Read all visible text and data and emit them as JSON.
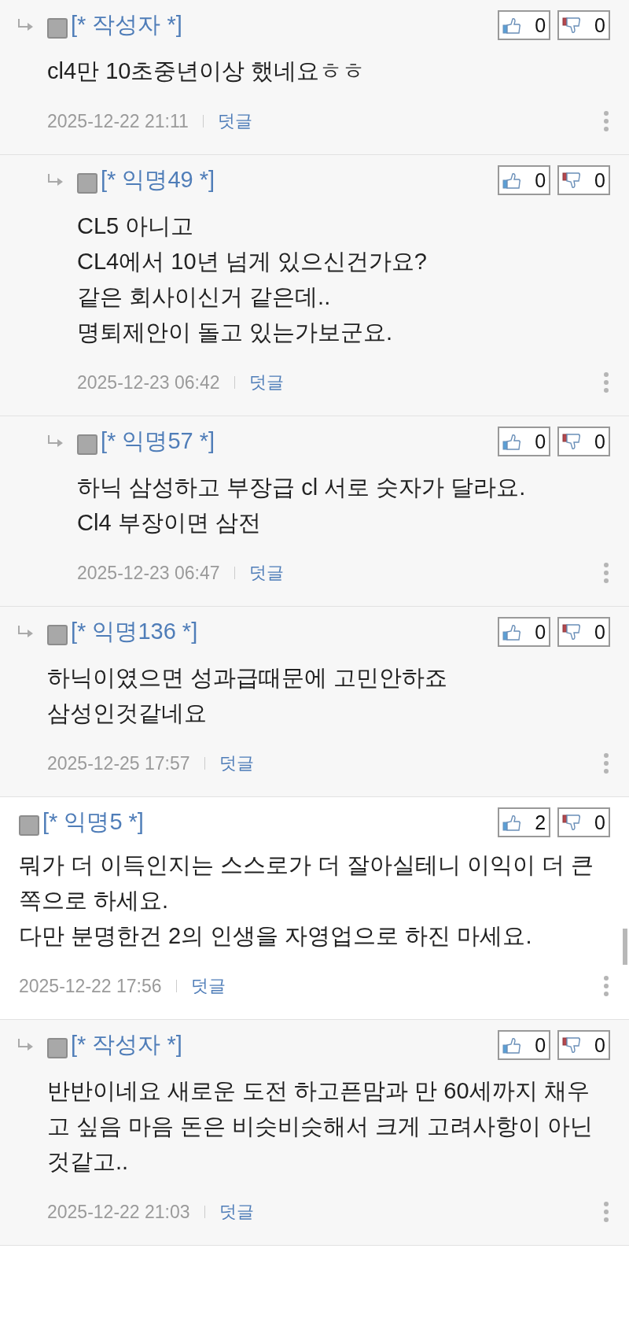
{
  "comments": [
    {
      "reply": true,
      "author": "[* 작성자 *]",
      "likes": "0",
      "dislikes": "0",
      "body": "cl4만 10초중년이상 했네요ㅎㅎ",
      "date": "2025-12-22 21:11",
      "reply_link": "덧글",
      "children": [
        {
          "reply": true,
          "author": "[* 익명49 *]",
          "likes": "0",
          "dislikes": "0",
          "body": "CL5 아니고\nCL4에서 10년 넘게 있으신건가요?\n같은 회사이신거 같은데..\n명퇴제안이 돌고 있는가보군요.",
          "date": "2025-12-23 06:42",
          "reply_link": "덧글"
        },
        {
          "reply": true,
          "author": "[* 익명57 *]",
          "likes": "0",
          "dislikes": "0",
          "body": "하닉 삼성하고 부장급 cl 서로 숫자가 달라요.\nCl4 부장이면 삼전",
          "date": "2025-12-23 06:47",
          "reply_link": "덧글"
        }
      ]
    },
    {
      "reply": true,
      "author": "[* 익명136 *]",
      "likes": "0",
      "dislikes": "0",
      "body": "하닉이였으면 성과급때문에 고민안하죠\n삼성인것같네요",
      "date": "2025-12-25 17:57",
      "reply_link": "덧글"
    },
    {
      "reply": false,
      "author": "[* 익명5 *]",
      "likes": "2",
      "dislikes": "0",
      "body": "뭐가 더 이득인지는 스스로가 더 잘아실테니 이익이 더 큰쪽으로 하세요.\n다만 분명한건 2의 인생을 자영업으로 하진 마세요.",
      "date": "2025-12-22 17:56",
      "reply_link": "덧글",
      "children": [
        {
          "reply": true,
          "author": "[* 작성자 *]",
          "likes": "0",
          "dislikes": "0",
          "body": "반반이네요 새로운 도전 하고픈맘과 만 60세까지 채우고 싶음 마음 돈은 비슷비슷해서 크게 고려사항이 아닌것같고..",
          "date": "2025-12-22 21:03",
          "reply_link": "덧글"
        }
      ]
    }
  ]
}
